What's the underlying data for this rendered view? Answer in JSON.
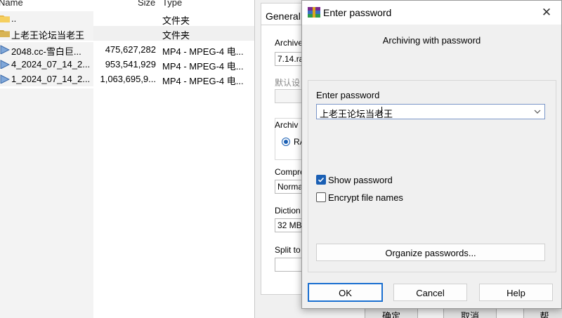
{
  "file_list": {
    "columns": {
      "name": "Name",
      "size": "Size",
      "type": "Type"
    },
    "rows": [
      {
        "name": "..",
        "size": "",
        "type": "文件夹",
        "icon": "folder-icon"
      },
      {
        "name": "上老王论坛当老王",
        "size": "",
        "type": "文件夹",
        "icon": "folder-icon"
      },
      {
        "name": "2048.cc-雪白巨...",
        "size": "475,627,282",
        "type": "MP4 - MPEG-4 电...",
        "icon": "video-file-icon"
      },
      {
        "name": "4_2024_07_14_2...",
        "size": "953,541,929",
        "type": "MP4 - MPEG-4 电...",
        "icon": "video-file-icon"
      },
      {
        "name": "1_2024_07_14_2...",
        "size": "1,063,695,9...",
        "type": "MP4 - MPEG-4 电...",
        "icon": "video-file-icon"
      }
    ]
  },
  "bg_dialog": {
    "tab_general": "General",
    "archive_label": "Archive",
    "archive_value": "7.14.ra",
    "default_label": "默认设",
    "format_label": "Archiv",
    "format_rar": "RA",
    "compression_label": "Compre",
    "compression_value": "Norma",
    "dictionary_label": "Diction",
    "dictionary_value": "32 MB",
    "split_label": "Split to",
    "ok_label": "确定",
    "cancel_label": "取消",
    "help_label": "帮",
    "edge_text": "s"
  },
  "password_dialog": {
    "title": "Enter password",
    "close_glyph": "✕",
    "subtitle": "Archiving with password",
    "enter_password_label": "Enter password",
    "password_value": "上老王论坛当老王",
    "show_password_label": "Show password",
    "show_password_checked": true,
    "encrypt_names_label": "Encrypt file names",
    "encrypt_names_checked": false,
    "organize_label": "Organize passwords...",
    "ok_label": "OK",
    "cancel_label": "Cancel",
    "help_label": "Help"
  },
  "colors": {
    "accent": "#1a5fb4",
    "dialog_bg": "#f0f0f0"
  }
}
